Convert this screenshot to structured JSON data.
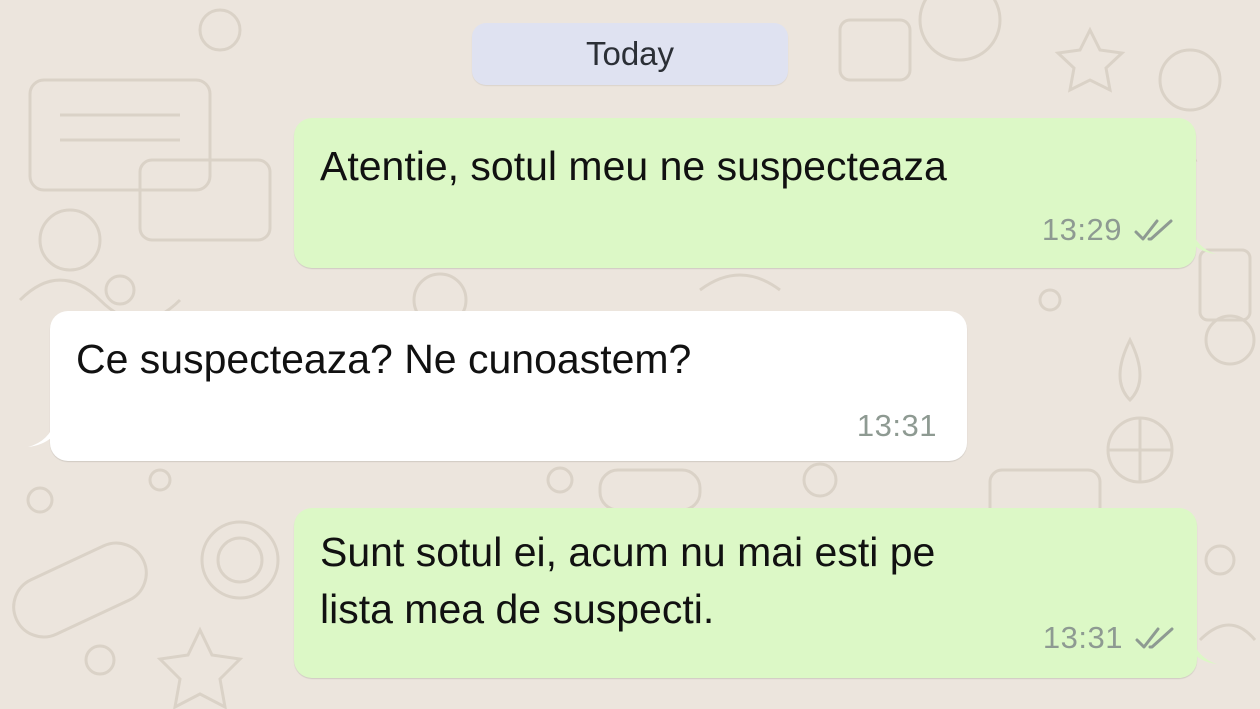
{
  "colors": {
    "background": "#ece5dd",
    "outgoing_bubble": "#dcf8c6",
    "incoming_bubble": "#ffffff",
    "date_pill": "#dfe2f1",
    "read_ticks": "#8e9a92"
  },
  "chat": {
    "date_label": "Today",
    "messages": [
      {
        "direction": "outgoing",
        "text": "Atentie, sotul meu ne suspecteaza",
        "time": "13:29",
        "status_icon": "double-check-icon"
      },
      {
        "direction": "incoming",
        "text": "Ce suspecteaza? Ne cunoastem?",
        "time": "13:31"
      },
      {
        "direction": "outgoing",
        "text": "Sunt sotul ei, acum nu mai esti pe\nlista mea de suspecti.",
        "time": "13:31",
        "status_icon": "double-check-icon"
      }
    ]
  }
}
